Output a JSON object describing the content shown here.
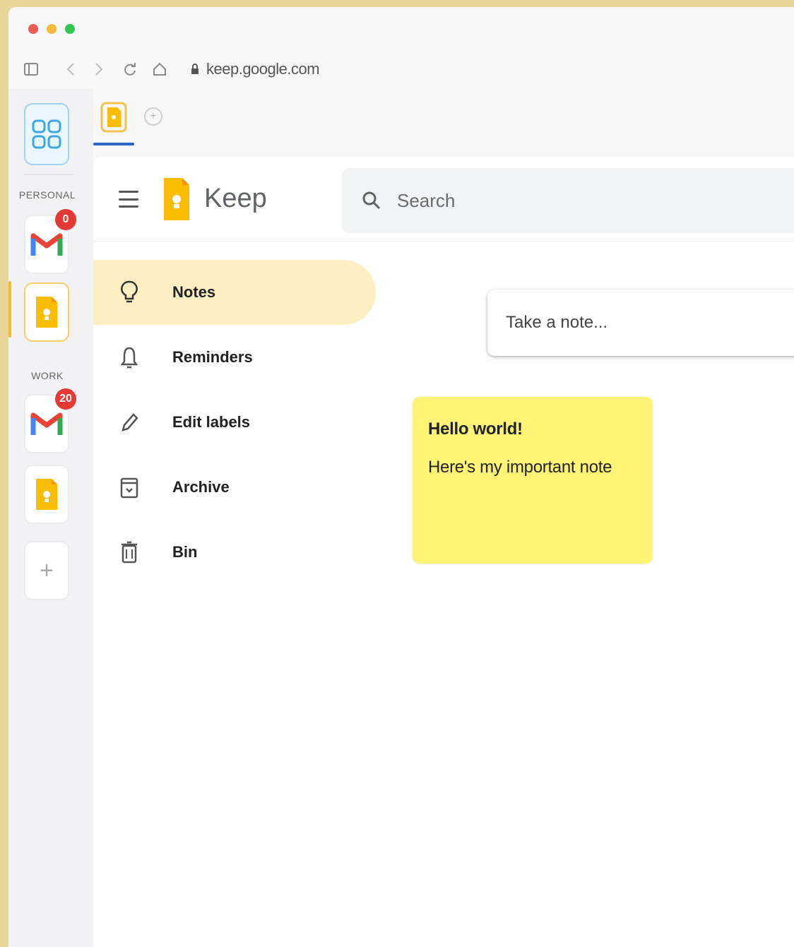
{
  "browser": {
    "url": "keep.google.com",
    "traffic_lights": {
      "close": "#ee5d55",
      "minimize": "#f6b93b",
      "maximize": "#31c553"
    }
  },
  "rail": {
    "sections": [
      {
        "label": "PERSONAL"
      },
      {
        "label": "WORK"
      }
    ],
    "apps": [
      {
        "name": "gmail",
        "badge": "0"
      },
      {
        "name": "keep",
        "badge": ""
      },
      {
        "name": "gmail",
        "badge": "20"
      },
      {
        "name": "keep",
        "badge": ""
      }
    ],
    "add_label": "+"
  },
  "header": {
    "app_title": "Keep",
    "search_placeholder": "Search"
  },
  "nav": {
    "items": [
      {
        "label": "Notes",
        "icon": "lightbulb-icon",
        "active": true
      },
      {
        "label": "Reminders",
        "icon": "bell-icon",
        "active": false
      },
      {
        "label": "Edit labels",
        "icon": "pencil-icon",
        "active": false
      },
      {
        "label": "Archive",
        "icon": "archive-icon",
        "active": false
      },
      {
        "label": "Bin",
        "icon": "trash-icon",
        "active": false
      }
    ]
  },
  "take_note": {
    "placeholder": "Take a note..."
  },
  "notes": [
    {
      "title": "Hello world!",
      "body": "Here's my important note",
      "color": "#fff475"
    }
  ],
  "colors": {
    "accent": "#f6b82b",
    "active_nav": "#feefc3",
    "tab_indicator": "#2a66c6"
  }
}
